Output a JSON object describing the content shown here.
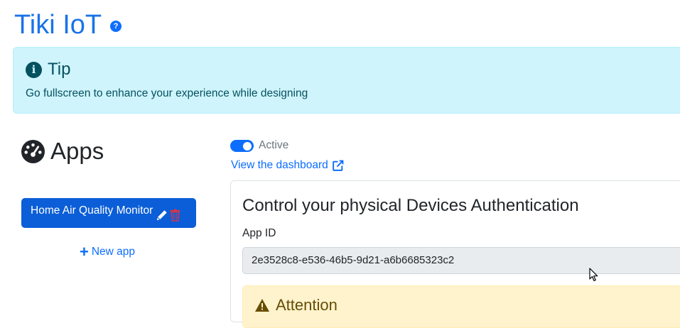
{
  "header": {
    "title": "Tiki IoT",
    "help_icon": "question-circle-icon"
  },
  "tip": {
    "icon": "info-circle-icon",
    "title": "Tip",
    "text": "Go fullscreen to enhance your experience while designing"
  },
  "sidebar": {
    "title": "Apps",
    "icon": "dashboard-gauge-icon",
    "apps": [
      {
        "label": "Home Air Quality Monitor",
        "edit_icon": "pencil-icon",
        "delete_icon": "trash-icon"
      }
    ],
    "new_app": {
      "icon": "plus-icon",
      "label": "New app"
    }
  },
  "main": {
    "active_toggle": {
      "checked": true,
      "label": "Active"
    },
    "dashboard_link": {
      "label": "View the dashboard",
      "icon": "external-link-icon"
    },
    "auth_card": {
      "title": "Control your physical Devices Authentication",
      "app_id_label": "App ID",
      "app_id_value": "2e3528c8-e536-46b5-9d21-a6b6685323c2",
      "attention": {
        "icon": "warning-triangle-icon",
        "title": "Attention"
      }
    }
  },
  "colors": {
    "primary": "#0d6efd",
    "title_blue": "#1a73e8",
    "tip_bg": "#cff4fc",
    "tip_text": "#055160",
    "danger": "#dc3545",
    "warning_bg": "#fff3cd"
  }
}
